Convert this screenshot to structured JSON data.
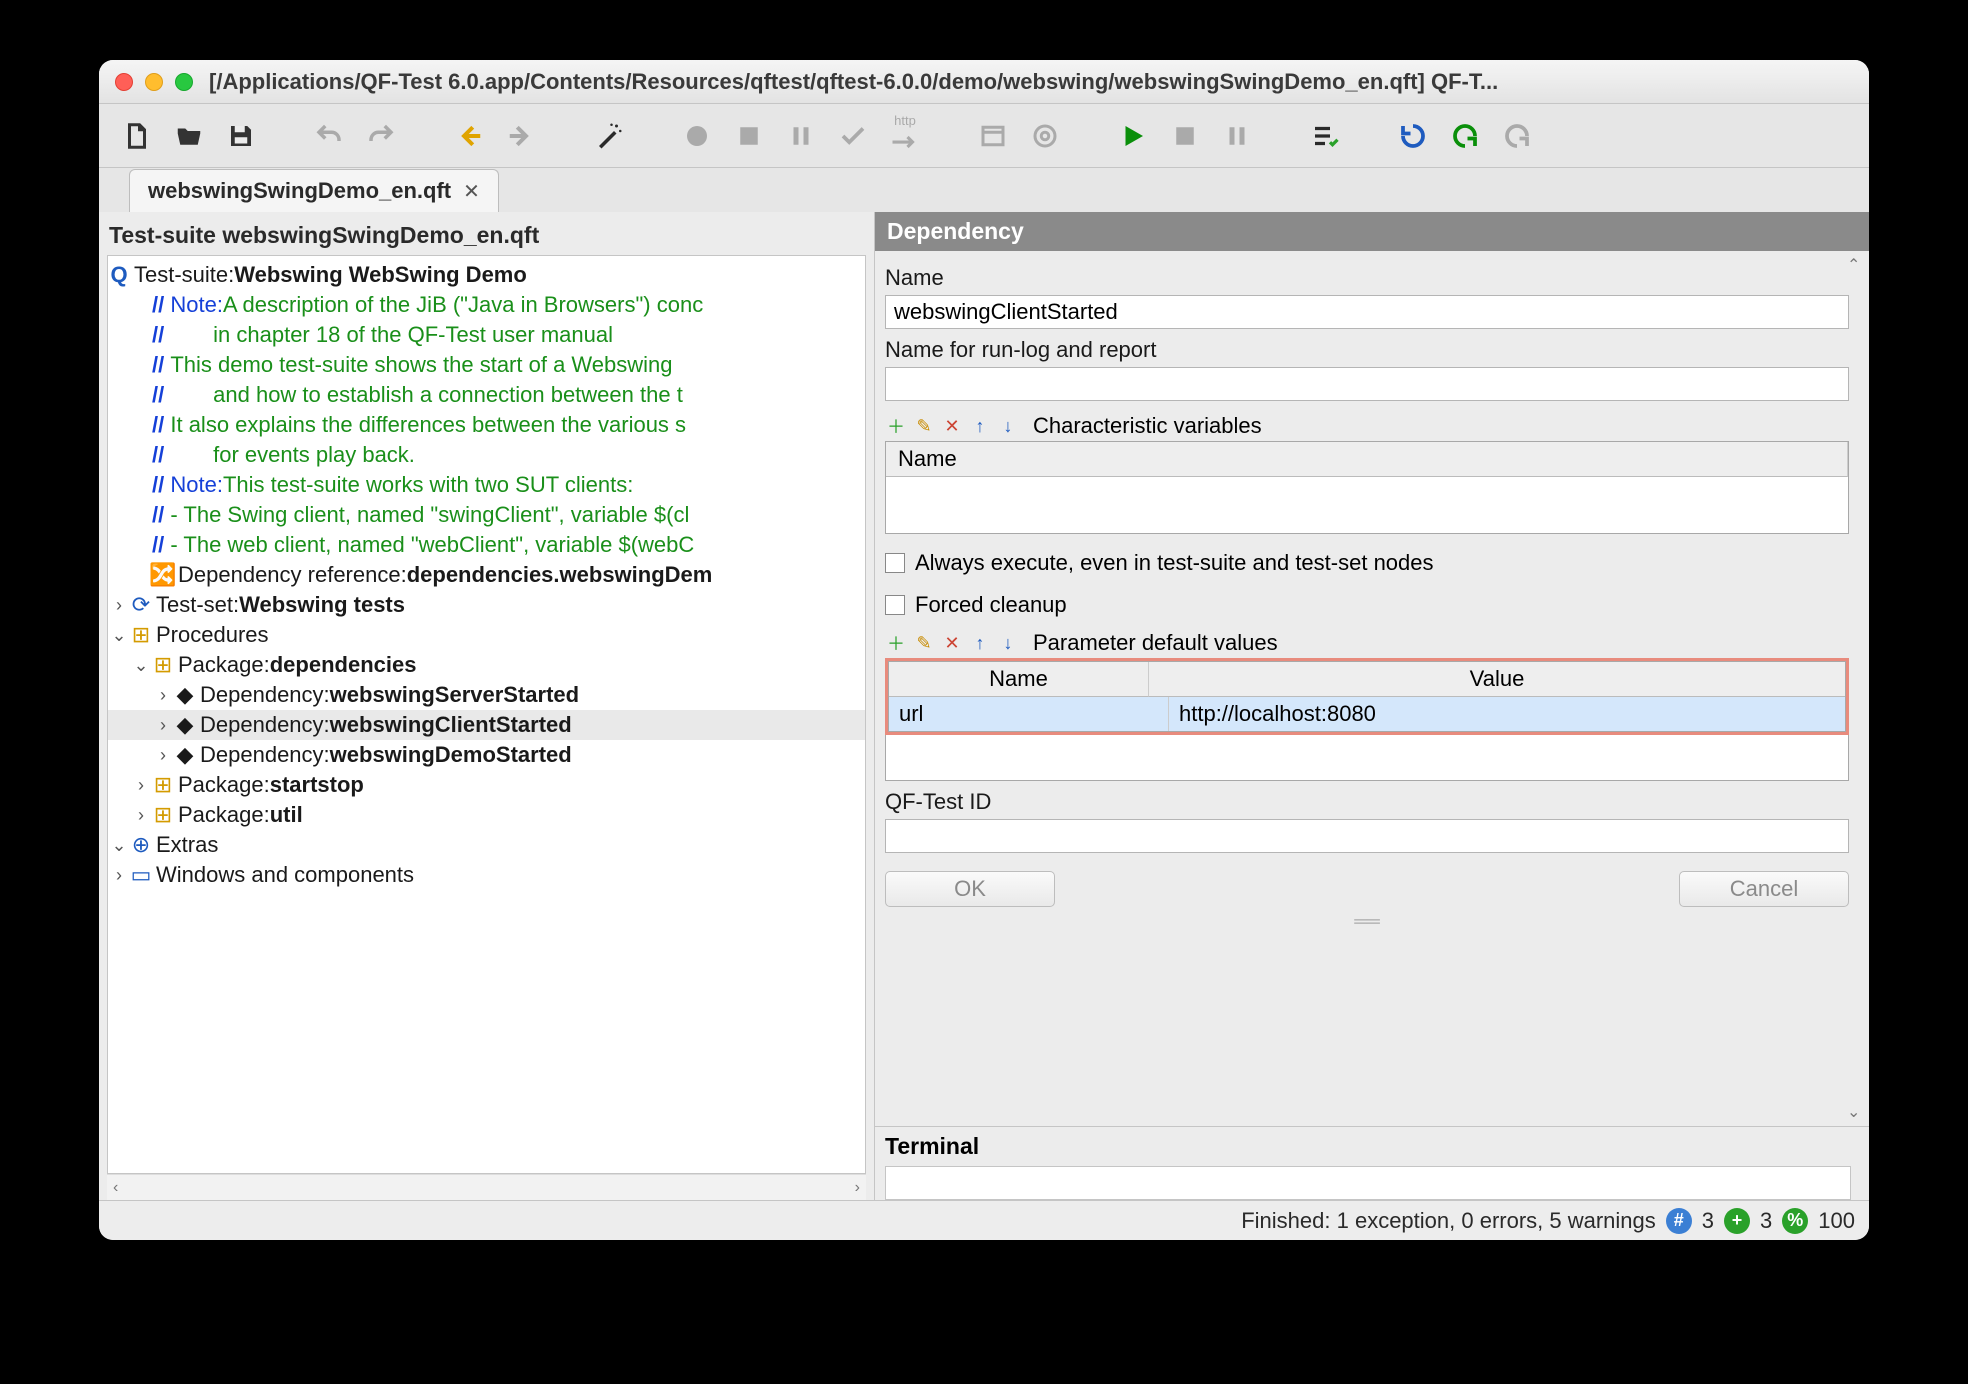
{
  "window": {
    "title": "[/Applications/QF-Test 6.0.app/Contents/Resources/qftest/qftest-6.0.0/demo/webswing/webswingSwingDemo_en.qft] QF-T..."
  },
  "tab": {
    "label": "webswingSwingDemo_en.qft"
  },
  "left": {
    "title": "Test-suite webswingSwingDemo_en.qft",
    "root": "Test-suite: ",
    "root_name": "Webswing WebSwing Demo",
    "notes": {
      "n1a": "Note:",
      "n1b": " A description of the JiB (\"Java in Browsers\") conc",
      "n2": "in chapter 18 of the QF-Test user manual",
      "n3": "This demo test-suite shows the start of a Webswing ",
      "n4": "and how to establish a connection between the t",
      "n5": "It also explains the differences between the various s",
      "n6": "for events play back.",
      "n7a": "Note:",
      "n7b": " This test-suite works with two SUT clients:",
      "n8": "- The Swing client, named \"swingClient\", variable $(cl",
      "n9": "- The web client, named \"webClient\", variable $(webC"
    },
    "depref_lbl": "Dependency reference: ",
    "depref_val": "dependencies.webswingDem",
    "testset_lbl": "Test-set: ",
    "testset_val": "Webswing tests",
    "procedures": "Procedures",
    "pkg_lbl": "Package: ",
    "pkg_dep": "dependencies",
    "dep_lbl": "Dependency: ",
    "dep1": "webswingServerStarted",
    "dep2": "webswingClientStarted",
    "dep3": "webswingDemoStarted",
    "pkg_ss": "startstop",
    "pkg_util": "util",
    "extras": "Extras",
    "wins": "Windows and components"
  },
  "right": {
    "header": "Dependency",
    "name_lbl": "Name",
    "name_val": "webswingClientStarted",
    "runlog_lbl": "Name for run-log and report",
    "charvar_lbl": "Characteristic variables",
    "charvar_col": "Name",
    "chk_always": "Always execute, even in test-suite and test-set nodes",
    "chk_forced": "Forced cleanup",
    "param_lbl": "Parameter default values",
    "param_col_name": "Name",
    "param_col_value": "Value",
    "param_row_name": "url",
    "param_row_value": "http://localhost:8080",
    "qfid_lbl": "QF-Test ID",
    "ok": "OK",
    "cancel": "Cancel",
    "terminal": "Terminal"
  },
  "status": {
    "text": "Finished: 1 exception, 0 errors, 5 warnings",
    "hash": "3",
    "plus": "3",
    "pct": "100"
  }
}
